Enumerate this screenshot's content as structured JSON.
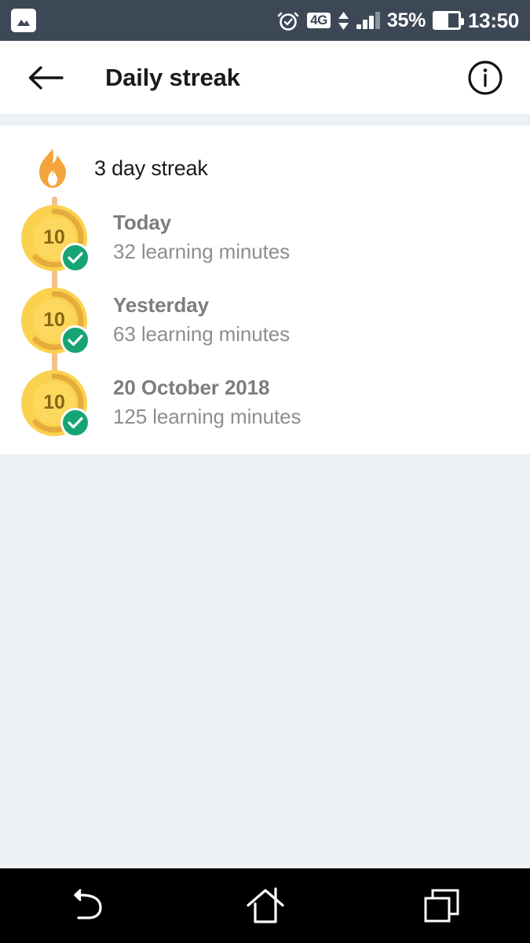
{
  "status_bar": {
    "gallery_icon": "gallery-icon",
    "alarm_icon": "alarm-clock-icon",
    "network_type": "4G",
    "data_arrows_icon": "data-transfer-arrows-icon",
    "signal_icon": "signal-bars-icon",
    "battery_percent": "35%",
    "battery_icon": "battery-icon",
    "time": "13:50",
    "background_color": "#3c4856"
  },
  "app_bar": {
    "back_icon": "back-arrow-icon",
    "title": "Daily streak",
    "info_icon": "info-circle-icon"
  },
  "streak": {
    "flame_icon": "flame-icon",
    "label": "3 day streak",
    "flame_color": "#f5a33c",
    "line_color": "#f4c08a",
    "coin_color": "#fbd24e",
    "coin_ring_color": "#e0a43a",
    "check_color": "#16a473",
    "entries": [
      {
        "coin_value": "10",
        "day": "Today",
        "minutes": "32 learning minutes",
        "completed": true
      },
      {
        "coin_value": "10",
        "day": "Yesterday",
        "minutes": "63 learning minutes",
        "completed": true
      },
      {
        "coin_value": "10",
        "day": "20 October 2018",
        "minutes": "125 learning minutes",
        "completed": true
      }
    ]
  },
  "nav_bar": {
    "back_icon": "nav-back-icon",
    "home_icon": "nav-home-icon",
    "recents_icon": "nav-recents-icon",
    "background_color": "#000000"
  }
}
